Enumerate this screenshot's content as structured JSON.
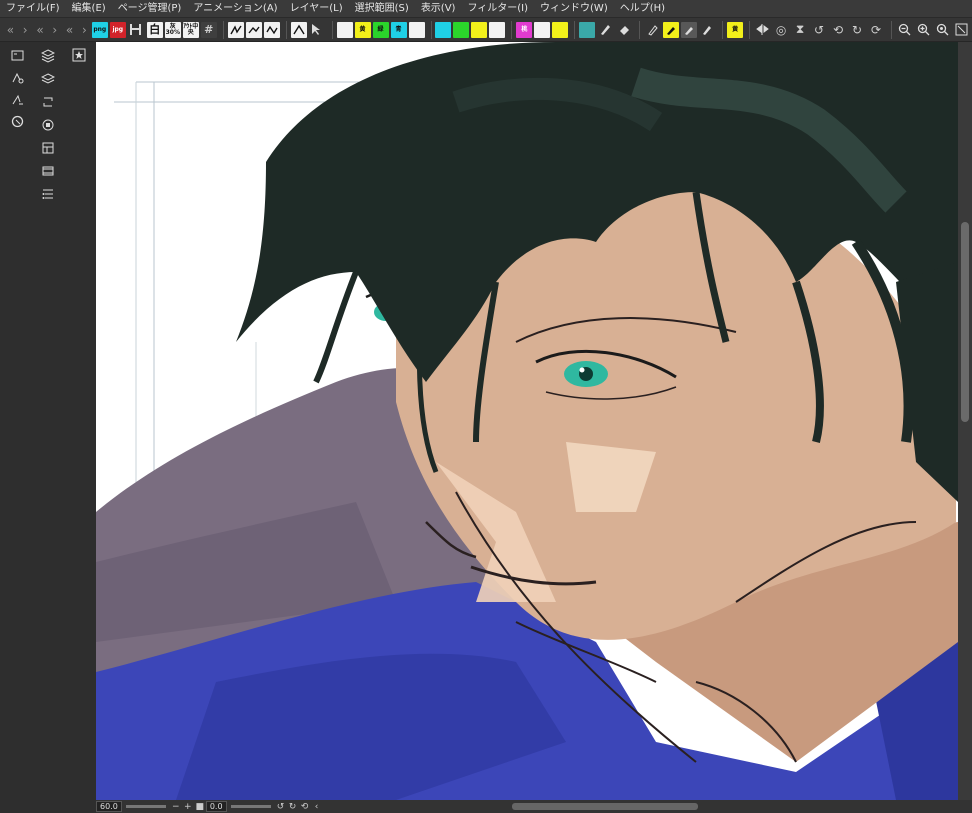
{
  "menu": {
    "items": [
      "ファイル(F)",
      "編集(E)",
      "ページ管理(P)",
      "アニメーション(A)",
      "レイヤー(L)",
      "選択範囲(S)",
      "表示(V)",
      "フィルター(I)",
      "ウィンドウ(W)",
      "ヘルプ(H)"
    ]
  },
  "toolbar": {
    "nav": [
      "«",
      "›",
      "«",
      "›",
      "«",
      "›"
    ],
    "btn_png": "png",
    "btn_jpg": "jpg",
    "btn_white": "白",
    "btn_30": "灰30%",
    "btn_center": "ｱｳﾄ中央",
    "btn_grid": "#",
    "btn_y1": "黄",
    "btn_g1": "緑",
    "btn_c1": "青",
    "btn_m1": "桃",
    "btn_y2": "黄"
  },
  "status": {
    "zoom": "60.0",
    "rotation": "0.0"
  },
  "colors": {
    "menu_bg": "#3a3a3a",
    "toolbar_bg": "#353535",
    "panel_bg": "#2e2e2e",
    "canvas_bg": "#ffffff",
    "hair": "#1e2a26",
    "skin": "#d8b094",
    "eye": "#2fb8a0",
    "jacket": "#3c46b8",
    "background_purple": "#7a6d80"
  }
}
